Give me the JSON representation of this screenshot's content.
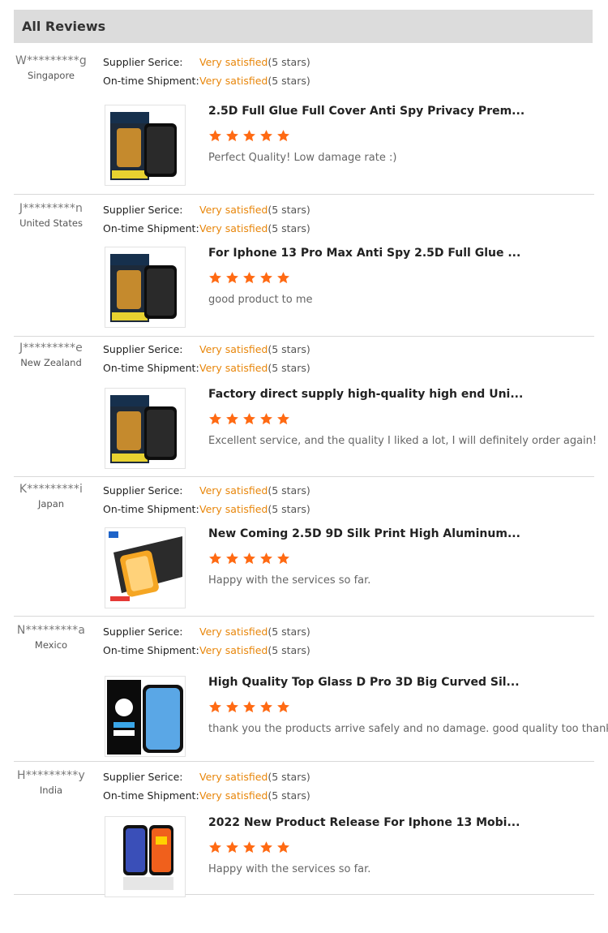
{
  "header": {
    "title": "All Reviews"
  },
  "star_color": "#ff6a13",
  "satisfied_color": "#e8860a",
  "labels": {
    "supplier": "Supplier Serice:",
    "shipment": "On-time Shipment:"
  },
  "reviews": [
    {
      "name": "W*********g",
      "country": "Singapore",
      "supplier_value": "Very satisfied",
      "supplier_stars": "(5 stars)",
      "shipment_value": "Very satisfied",
      "shipment_stars": "(5 stars)",
      "product_title": "2.5D Full Glue Full Cover Anti Spy Privacy Prem...",
      "rating": 5,
      "comment": "Perfect Quality! Low damage rate :)",
      "product_image": "privacy-screen-protector-box"
    },
    {
      "name": "J*********n",
      "country": "United States",
      "supplier_value": "Very satisfied",
      "supplier_stars": "(5 stars)",
      "shipment_value": "Very satisfied",
      "shipment_stars": "(5 stars)",
      "product_title": "For Iphone 13 Pro Max Anti Spy 2.5D Full Glue ...",
      "rating": 5,
      "comment": "good product to me",
      "product_image": "privacy-screen-protector-box"
    },
    {
      "name": "J*********e",
      "country": "New Zealand",
      "supplier_value": "Very satisfied",
      "supplier_stars": "(5 stars)",
      "shipment_value": "Very satisfied",
      "shipment_stars": "(5 stars)",
      "product_title": "Factory direct supply high-quality high end Uni...",
      "rating": 5,
      "comment": "Excellent service, and the quality I liked a lot, I will definitely order again!",
      "product_image": "privacy-screen-protector-box"
    },
    {
      "name": "K*********i",
      "country": "Japan",
      "supplier_value": "Very satisfied",
      "supplier_stars": "(5 stars)",
      "shipment_value": "Very satisfied",
      "shipment_stars": "(5 stars)",
      "product_title": "New Coming 2.5D 9D Silk Print High Aluminum...",
      "rating": 5,
      "comment": "Happy with the services so far.",
      "product_image": "tempered-glass-orange"
    },
    {
      "name": "N*********a",
      "country": "Mexico",
      "supplier_value": "Very satisfied",
      "supplier_stars": "(5 stars)",
      "shipment_value": "Very satisfied",
      "shipment_stars": "(5 stars)",
      "product_title": "High Quality Top Glass D Pro 3D Big Curved Sil...",
      "rating": 5,
      "comment": "thank you the products arrive safely and no damage. good quality too thank you",
      "product_image": "top-glass-box"
    },
    {
      "name": "H*********y",
      "country": "India",
      "supplier_value": "Very satisfied",
      "supplier_stars": "(5 stars)",
      "shipment_value": "Very satisfied",
      "shipment_stars": "(5 stars)",
      "product_title": "2022 New Product Release For Iphone 13 Mobi...",
      "rating": 5,
      "comment": "Happy with the services so far.",
      "product_image": "phone-glass-orange"
    }
  ]
}
